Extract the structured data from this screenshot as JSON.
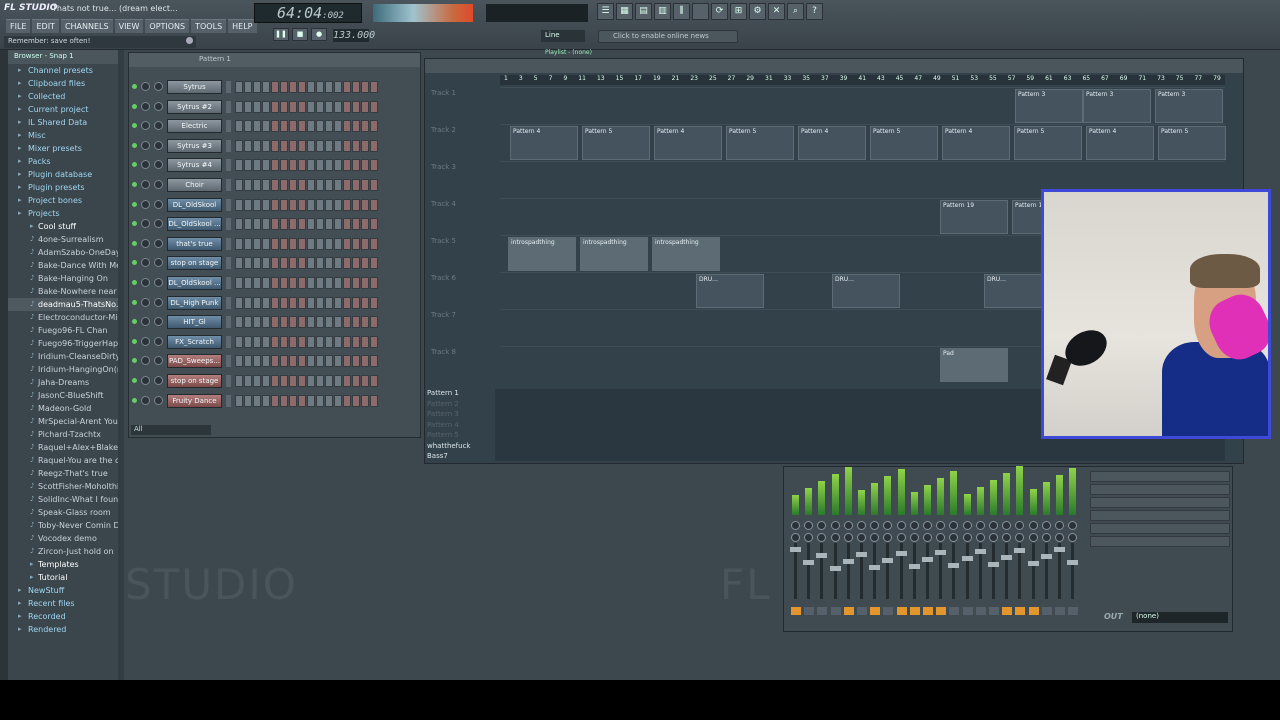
{
  "app": {
    "logo": "FL STUDIO",
    "title": "Thats not true... (dream elect...",
    "hint": "Remember: save often!"
  },
  "menu": [
    "FILE",
    "EDIT",
    "CHANNELS",
    "VIEW",
    "OPTIONS",
    "TOOLS",
    "HELP"
  ],
  "transport": {
    "time": "64:04",
    "time_ticks": ":002",
    "tempo": "133.000",
    "buttons": [
      "pause",
      "stop",
      "record"
    ]
  },
  "toolbar": {
    "snap": "Line",
    "news": "Click to enable online news"
  },
  "playlist": {
    "title": "Playlist - (none)",
    "ruler": [
      "1",
      "3",
      "5",
      "7",
      "9",
      "11",
      "13",
      "15",
      "17",
      "19",
      "21",
      "23",
      "25",
      "27",
      "29",
      "31",
      "33",
      "35",
      "37",
      "39",
      "41",
      "43",
      "45",
      "47",
      "49",
      "51",
      "53",
      "55",
      "57",
      "59",
      "61",
      "63",
      "65",
      "67",
      "69",
      "71",
      "73",
      "75",
      "77",
      "79"
    ],
    "tracks": [
      "Track 1",
      "Track 2",
      "Track 3",
      "Track 4",
      "Track 5",
      "Track 6",
      "Track 7",
      "Track 8"
    ],
    "clips": [
      {
        "track": 0,
        "label": "Pattern 3"
      },
      {
        "track": 1,
        "label": "Pattern 4"
      },
      {
        "track": 1,
        "label": "Pattern 5"
      },
      {
        "track": 3,
        "label": "Pattern 19"
      },
      {
        "track": 4,
        "label": "introspadthing"
      },
      {
        "track": 5,
        "label": "DRU..."
      },
      {
        "track": 7,
        "label": "Pad"
      }
    ],
    "patterns": [
      "Pattern 1",
      "Pattern 2",
      "Pattern 3",
      "Pattern 4",
      "Pattern 5",
      "whatthefuck",
      "Bass7"
    ]
  },
  "browser": {
    "header": "Browser - Snap 1",
    "items": [
      {
        "label": "Channel presets",
        "type": "folder"
      },
      {
        "label": "Clipboard files",
        "type": "folder"
      },
      {
        "label": "Collected",
        "type": "folder"
      },
      {
        "label": "Current project",
        "type": "folder"
      },
      {
        "label": "IL Shared Data",
        "type": "folder"
      },
      {
        "label": "Misc",
        "type": "folder"
      },
      {
        "label": "Mixer presets",
        "type": "folder"
      },
      {
        "label": "Packs",
        "type": "folder"
      },
      {
        "label": "Plugin database",
        "type": "folder"
      },
      {
        "label": "Plugin presets",
        "type": "folder"
      },
      {
        "label": "Project bones",
        "type": "folder"
      },
      {
        "label": "Projects",
        "type": "folder"
      },
      {
        "label": "Cool stuff",
        "type": "subfolder"
      },
      {
        "label": "4one-Surrealism",
        "type": "file"
      },
      {
        "label": "AdamSzabo-OneDay(...",
        "type": "file"
      },
      {
        "label": "Bake-Dance With Me",
        "type": "file"
      },
      {
        "label": "Bake-Hanging On",
        "type": "file"
      },
      {
        "label": "Bake-Nowhere near",
        "type": "file"
      },
      {
        "label": "deadmau5-ThatsNo...",
        "type": "file-active"
      },
      {
        "label": "Electroconductor-Mid...",
        "type": "file"
      },
      {
        "label": "Fuego96-FL Chan",
        "type": "file"
      },
      {
        "label": "Fuego96-TriggerHappy",
        "type": "file"
      },
      {
        "label": "Iridium-CleanseDirty",
        "type": "file"
      },
      {
        "label": "Iridium-HangingOn(re...",
        "type": "file"
      },
      {
        "label": "Jaha-Dreams",
        "type": "file"
      },
      {
        "label": "JasonC-BlueShift",
        "type": "file"
      },
      {
        "label": "Madeon-Gold",
        "type": "file"
      },
      {
        "label": "MrSpecial-Arent YouCl...",
        "type": "file"
      },
      {
        "label": "Pichard-Tzachtx",
        "type": "file"
      },
      {
        "label": "Raquel+Alex+Blake-M...",
        "type": "file"
      },
      {
        "label": "Raquel-You are the o...",
        "type": "file"
      },
      {
        "label": "Reegz-That's true",
        "type": "file"
      },
      {
        "label": "ScottFisher-Moholthi...",
        "type": "file"
      },
      {
        "label": "SolidInc-What I found",
        "type": "file"
      },
      {
        "label": "Speak-Glass room",
        "type": "file"
      },
      {
        "label": "Toby-Never Comin D...",
        "type": "file"
      },
      {
        "label": "Vocodex demo",
        "type": "file"
      },
      {
        "label": "Zircon-Just hold on",
        "type": "file"
      },
      {
        "label": "Templates",
        "type": "subfolder"
      },
      {
        "label": "Tutorial",
        "type": "subfolder"
      },
      {
        "label": "NewStuff",
        "type": "folder"
      },
      {
        "label": "Recent files",
        "type": "folder"
      },
      {
        "label": "Recorded",
        "type": "folder"
      },
      {
        "label": "Rendered",
        "type": "folder"
      }
    ]
  },
  "rack": {
    "pattern": "Pattern 1",
    "filter": "All",
    "channels": [
      {
        "name": "Sytrus",
        "color": "gray"
      },
      {
        "name": "Sytrus #2",
        "color": "gray"
      },
      {
        "name": "Electric",
        "color": "gray"
      },
      {
        "name": "Sytrus #3",
        "color": "gray"
      },
      {
        "name": "Sytrus #4",
        "color": "gray"
      },
      {
        "name": "Choir",
        "color": "gray"
      },
      {
        "name": "DL_OldSkool",
        "color": "blue"
      },
      {
        "name": "DL_OldSkool ...",
        "color": "blue"
      },
      {
        "name": "that's true",
        "color": "blue"
      },
      {
        "name": "stop on stage",
        "color": "blue"
      },
      {
        "name": "DL_OldSkool ...",
        "color": "blue"
      },
      {
        "name": "DL_High Punk",
        "color": "blue"
      },
      {
        "name": "HIT_Gl",
        "color": "blue"
      },
      {
        "name": "FX_Scratch",
        "color": "blue"
      },
      {
        "name": "PAD_Sweeps...",
        "color": "red"
      },
      {
        "name": "stop on stage",
        "color": "red"
      },
      {
        "name": "Fruity Dance",
        "color": "red"
      }
    ]
  },
  "mixer": {
    "out_label": "OUT",
    "out_value": "(none)"
  },
  "watermark": {
    "left": "STUDIO",
    "right": "FL"
  },
  "colors": {
    "accent": "#e3962d",
    "webcam_border": "#3e49d8",
    "bg": "#3d474e"
  }
}
